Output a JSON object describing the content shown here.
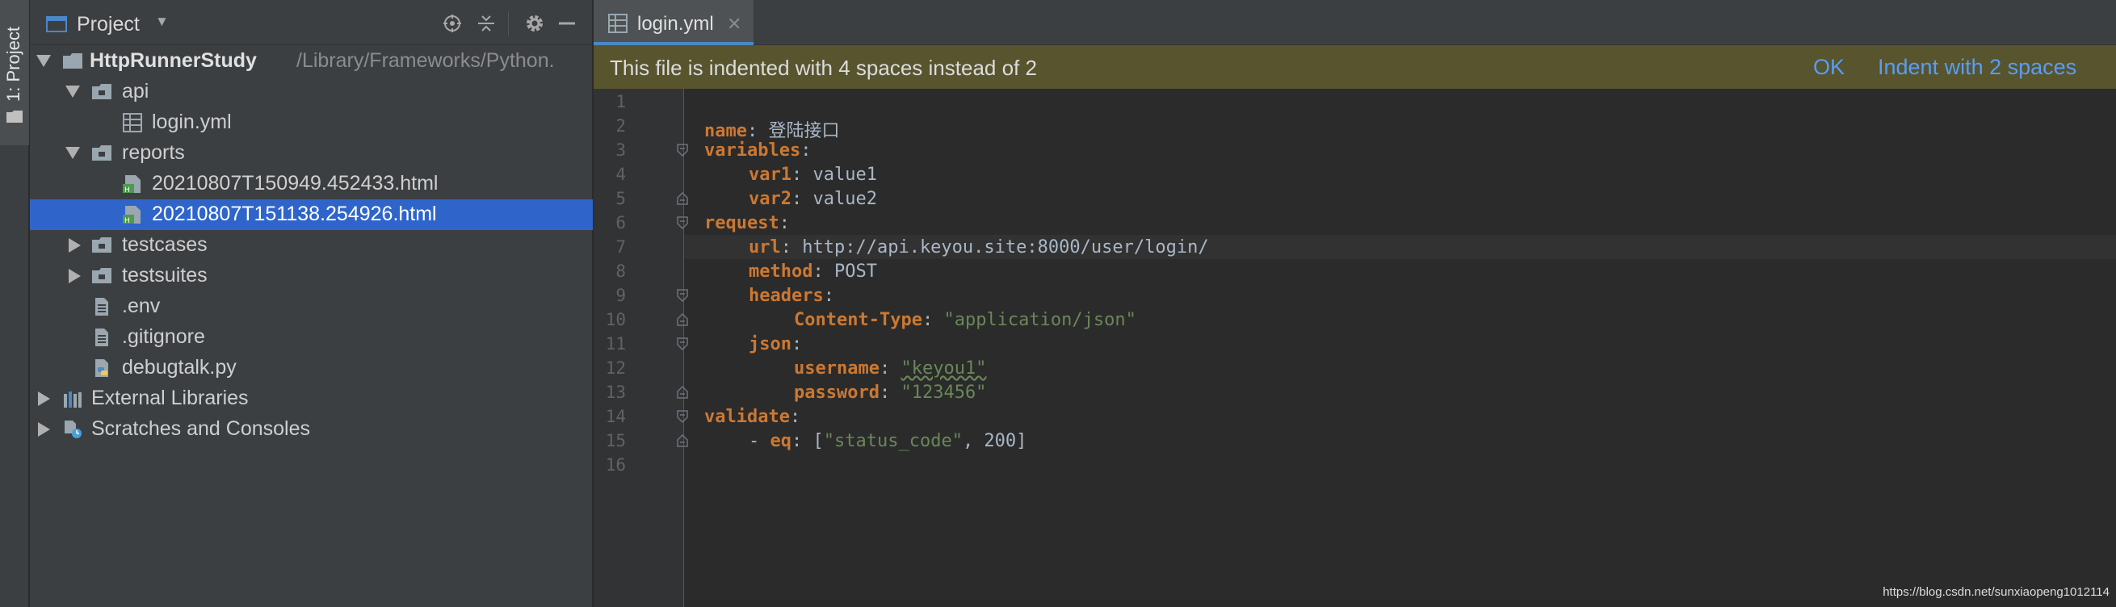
{
  "tool_strip": {
    "project_tab_label": "1: Project"
  },
  "project_panel": {
    "title": "Project",
    "tree": [
      {
        "id": "root",
        "label": "HttpRunnerStudy",
        "path": "/Library/Frameworks/Python.",
        "icon": "folder-icon",
        "expanded": true
      },
      {
        "id": "api",
        "label": "api",
        "icon": "folder-icon",
        "expanded": true
      },
      {
        "id": "login-yml",
        "label": "login.yml",
        "icon": "yaml-file-icon"
      },
      {
        "id": "reports",
        "label": "reports",
        "icon": "folder-icon",
        "expanded": true
      },
      {
        "id": "report1",
        "label": "20210807T150949.452433.html",
        "icon": "html-file-icon"
      },
      {
        "id": "report2",
        "label": "20210807T151138.254926.html",
        "icon": "html-file-icon",
        "selected": true
      },
      {
        "id": "testcases",
        "label": "testcases",
        "icon": "folder-icon",
        "expanded": false
      },
      {
        "id": "testsuites",
        "label": "testsuites",
        "icon": "folder-icon",
        "expanded": false
      },
      {
        "id": "env",
        "label": ".env",
        "icon": "text-file-icon"
      },
      {
        "id": "gitignore",
        "label": ".gitignore",
        "icon": "text-file-icon"
      },
      {
        "id": "debugtalk",
        "label": "debugtalk.py",
        "icon": "python-file-icon"
      },
      {
        "id": "ext-libs",
        "label": "External Libraries",
        "icon": "library-icon",
        "expanded": false
      },
      {
        "id": "scratches",
        "label": "Scratches and Consoles",
        "icon": "scratches-icon",
        "expanded": false
      }
    ]
  },
  "editor": {
    "tab": {
      "label": "login.yml"
    },
    "banner": {
      "message": "This file is indented with 4 spaces instead of 2",
      "ok_label": "OK",
      "indent_label": "Indent with 2 spaces"
    },
    "line_numbers": [
      "1",
      "2",
      "3",
      "4",
      "5",
      "6",
      "7",
      "8",
      "9",
      "10",
      "11",
      "12",
      "13",
      "14",
      "15",
      "16"
    ],
    "code": {
      "l2_key": "name",
      "l2_val": " 登陆接口",
      "l3_key": "variables",
      "l4_key": "var1",
      "l4_val": " value1",
      "l5_key": "var2",
      "l5_val": " value2",
      "l6_key": "request",
      "l7_key": "url",
      "l7_val": " http://api.keyou.site:8000/user/login/",
      "l8_key": "method",
      "l8_val": " POST",
      "l9_key": "headers",
      "l10_key": "Content-Type",
      "l10_val": "\"application/json\"",
      "l11_key": "json",
      "l12_key": "username",
      "l12_val": "\"keyou1\"",
      "l13_key": "password",
      "l13_val": "\"123456\"",
      "l14_key": "validate",
      "l15_dash": "- ",
      "l15_key": "eq",
      "l15_open": " [",
      "l15_str": "\"status_code\"",
      "l15_rest": ", 200]"
    }
  },
  "watermark": "https://blog.csdn.net/sunxiaopeng1012114",
  "colors": {
    "selection": "#2f65ca",
    "banner_bg": "#57542e",
    "link": "#589df6",
    "yaml_key": "#cc7832",
    "yaml_string": "#6a8759"
  }
}
